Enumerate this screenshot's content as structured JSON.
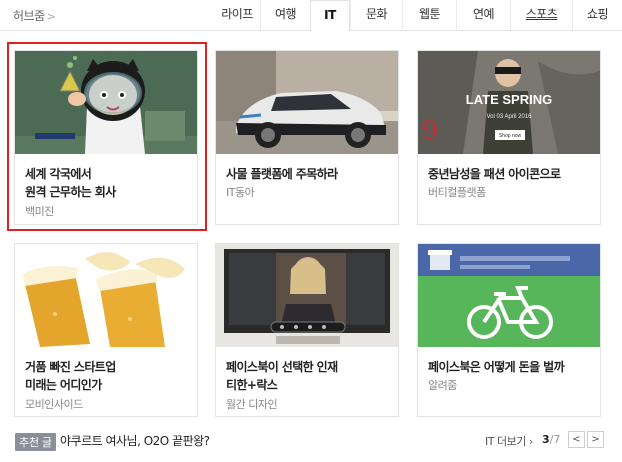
{
  "header": {
    "hub_label": "허브줌",
    "hub_chevron": ">",
    "tabs": [
      {
        "label": "라이프"
      },
      {
        "label": "여행"
      },
      {
        "label": "IT"
      },
      {
        "label": "문화"
      },
      {
        "label": "웹툰"
      },
      {
        "label": "연예"
      },
      {
        "label": "스포츠"
      },
      {
        "label": "쇼핑"
      }
    ],
    "active_tab": "IT"
  },
  "cards": [
    {
      "title_line1": "세계 각국에서",
      "title_line2": "원격 근무하는 회사",
      "source": "백미진"
    },
    {
      "title_line1": "사물 플랫폼에 주목하라",
      "title_line2": "",
      "source": "IT동아"
    },
    {
      "title_line1": "중년남성을 패션 아이콘으로",
      "title_line2": "",
      "source": "버티컬플랫폼"
    },
    {
      "title_line1": "거품 빠진 스타트업",
      "title_line2": "미래는 어디인가",
      "source": "모비인사이드"
    },
    {
      "title_line1": "페이스북이 선택한 인재",
      "title_line2": "티한+락스",
      "source": "월간 디자인"
    },
    {
      "title_line1": "페이스북은 어떻게 돈을 벌까",
      "title_line2": "",
      "source": "알려줌"
    }
  ],
  "thumb_text": {
    "late_spring": "LATE SPRING",
    "vol": "Vol 03 April 2016",
    "shop_now": "Shop now"
  },
  "footer": {
    "rec_badge": "추천 글",
    "rec_link": "야쿠르트 여사님, O2O 끝판왕?",
    "more_label": "IT 더보기",
    "more_chevron": "›",
    "page_current": "3",
    "page_total": "/7",
    "prev": "<",
    "next": ">"
  },
  "colors": {
    "selection_border": "#e02020",
    "facebook_blue": "#4a67a8",
    "facebook_green": "#57b65a"
  }
}
